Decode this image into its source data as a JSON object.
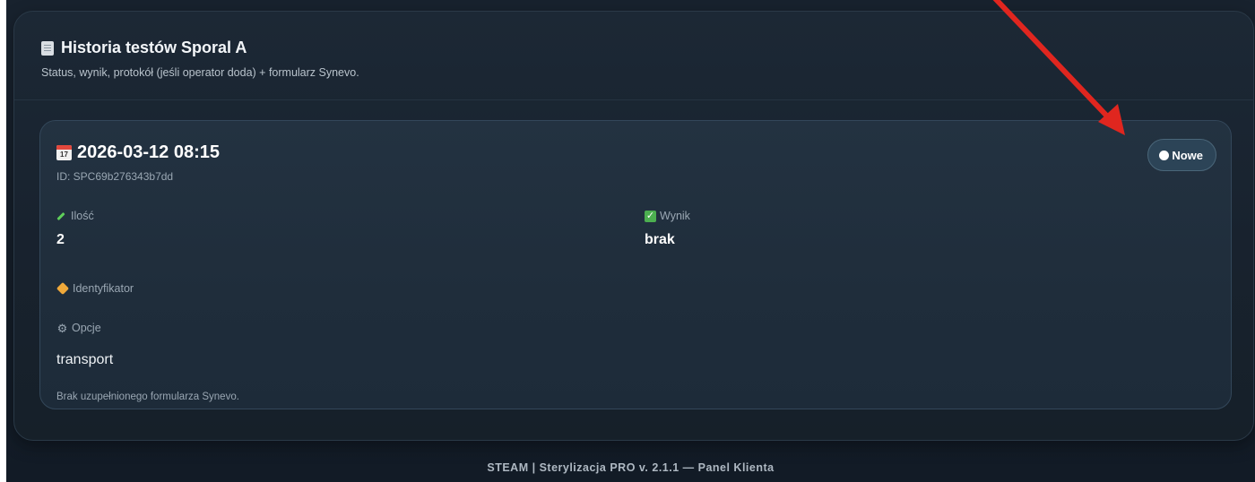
{
  "panel": {
    "title": "Historia testów Sporal A",
    "subtitle": "Status, wynik, protokół (jeśli operator doda) + formularz Synevo."
  },
  "card": {
    "date": "2026-03-12 08:15",
    "id": "ID: SPC69b276343b7dd",
    "status": "Nowe",
    "fields": {
      "quantity_label": "Ilość",
      "quantity_value": "2",
      "result_label": "Wynik",
      "result_value": "brak",
      "identifier_label": "Identyfikator",
      "options_label": "Opcje",
      "options_value": "transport"
    },
    "synevo_note": "Brak uzupełnionego formularza Synevo."
  },
  "footer": {
    "text": "STEAM | Sterylizacja PRO v. 2.1.1 — Panel Klienta"
  },
  "icons": {
    "title_icon": "document-icon",
    "date_icon": "calendar-icon",
    "quantity_icon": "pencil-icon",
    "result_icon": "checkbox-icon",
    "identifier_icon": "tag-icon",
    "options_icon": "gear-icon"
  },
  "colors": {
    "background": "#121b26",
    "card": "#233241",
    "badge": "#2c4457",
    "annotation_arrow": "#e0261f"
  }
}
